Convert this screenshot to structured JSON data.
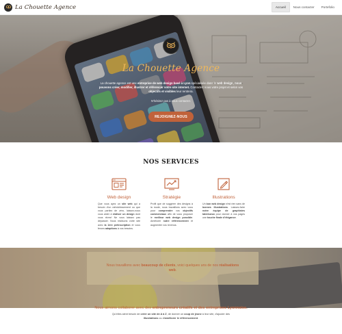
{
  "navbar": {
    "brand": "La Chouette Agence",
    "links": [
      {
        "label": "Accueil",
        "active": true
      },
      {
        "label": "Nous contacter",
        "active": false
      },
      {
        "label": "Portefolio",
        "active": false
      }
    ]
  },
  "hero": {
    "title": "La Chouette Agence",
    "text_parts": [
      "La chouette agence est une ",
      "entreprise de web design basé à Lyon",
      " spécialisée dans le ",
      "web design",
      ", nous pouvons créer, modifier, illustrer et référencer votre site internet.",
      " Contactez nous votre projet et selon vos ",
      "objectifs et visibles",
      " leur rentrera."
    ],
    "note": "N'hésitez pas à nous contacter.",
    "cta": "REJOIGNEZ-NOUS"
  },
  "services": {
    "title": "NOS SERVICES",
    "items": [
      {
        "icon": "browser-window-icon",
        "name": "Web design",
        "text_parts": [
          "Que vous ayez un ",
          "site web",
          " qui a besoin d'un rafraîchissement ou que vous partiez de zéro, laissez-nous vous aider à ",
          "réaliser un design",
          " dont vous rêvez! Ne vous laissez pas dépasser. Nous réalisons votre site avec ",
          "la 1ère préinscription",
          " et vous ferons ",
          "adaptions",
          " à vos besoins."
        ]
      },
      {
        "icon": "trending-chart-icon",
        "name": "Stratégie",
        "text_parts": [
          "Profit que de suggérer des designs à la mode, nous travaillons avec vous pour ",
          "comprendre",
          " vos ",
          "objectifs commerciaux",
          " afin de vous proposer le ",
          "meilleur web design possible",
          ". Améliorer ",
          "notre référencement",
          " et augmenter vos revenus."
        ]
      },
      {
        "icon": "pencil-drawing-icon",
        "name": "Illustrations",
        "text_parts": [
          "Un ",
          "bon web design",
          " n'est rien sans de ",
          "bonnes illustrations",
          ". Laissez-faire ",
          "notre équipe de graphistes talentueux",
          " pour donner à vos pages une ",
          "touche finale d'élégance",
          "."
        ]
      }
    ]
  },
  "banner": {
    "text_parts": [
      "Nous travaillons avec ",
      "beaucoup de clients",
      ", voici quelques uns de nos ",
      "réalisations web",
      "."
    ]
  },
  "partners": {
    "title_parts": [
      "Nous aimons collaborer avec des ",
      "entrepreneurs créatifs et des entreprises Lyonnaise."
    ],
    "text_parts": [
      "Qu'elles aient besoin de ",
      "créer un site de A à Z",
      ", de donner un ",
      "coup de jeune",
      " à leur site, d'ajouter des ",
      "illustrations",
      " ou d'",
      "améliorer le référencement",
      "."
    ]
  },
  "colors": {
    "accent": "#c0623a",
    "hero_title": "#f0b85a"
  }
}
